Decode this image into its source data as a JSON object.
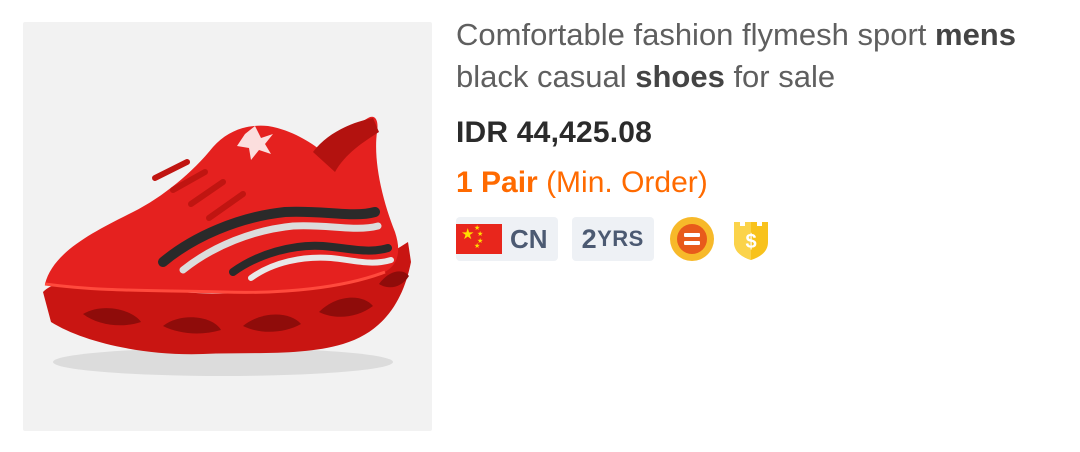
{
  "product": {
    "title_parts": [
      {
        "text": "Comfortable fashion flymesh sport ",
        "bold": false
      },
      {
        "text": "mens",
        "bold": true
      },
      {
        "text": " black casual ",
        "bold": false
      },
      {
        "text": "shoes",
        "bold": true
      },
      {
        "text": " for sale",
        "bold": false
      }
    ],
    "price": "IDR 44,425.08",
    "moq_quantity": "1 Pair",
    "moq_label": " (Min. Order)",
    "image_alt": "red sports shoe"
  },
  "supplier": {
    "country_code": "CN",
    "years_num": "2",
    "years_label": "YRS"
  },
  "colors": {
    "accent_orange": "#ff6a00",
    "badge_bg": "#eef1f5",
    "badge_text": "#4c5a72",
    "shoe_red": "#e5211f"
  },
  "icons": {
    "flag": "china-flag-icon",
    "trade_assurance": "trade-assurance-icon",
    "verified": "verified-shield-icon"
  }
}
